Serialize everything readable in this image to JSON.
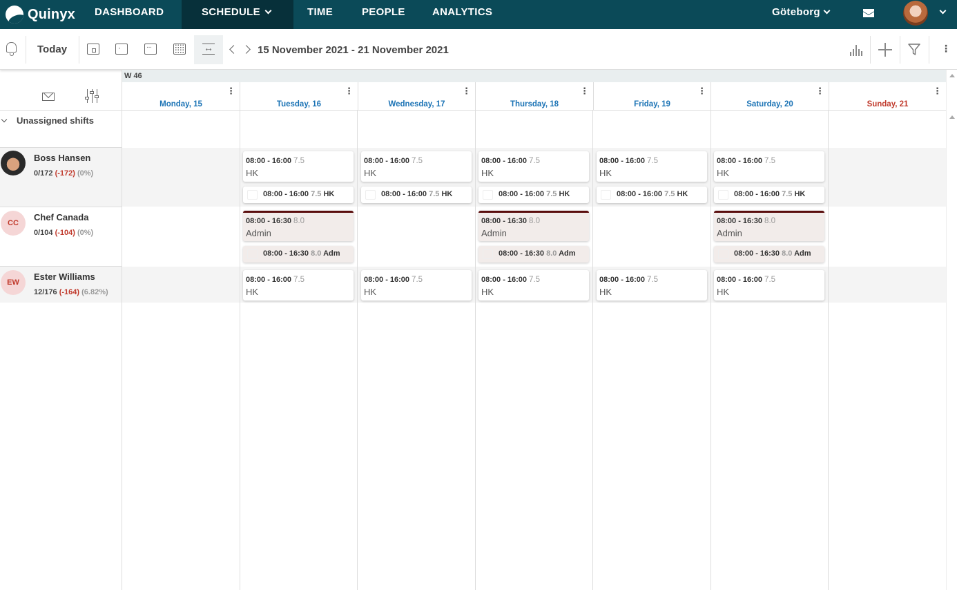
{
  "nav": {
    "logo": "Quinyx",
    "items": [
      "DASHBOARD",
      "SCHEDULE",
      "TIME",
      "PEOPLE",
      "ANALYTICS"
    ],
    "location": "Göteborg"
  },
  "toolbar": {
    "today": "Today",
    "date_range": "15 November 2021 - 21 November 2021"
  },
  "week": {
    "label": "W 46"
  },
  "days": [
    "Monday, 15",
    "Tuesday, 16",
    "Wednesday, 17",
    "Thursday, 18",
    "Friday, 19",
    "Saturday, 20",
    "Sunday, 21"
  ],
  "unassigned": {
    "label": "Unassigned shifts"
  },
  "employees": [
    {
      "name": "Boss Hansen",
      "stats1": "0/172",
      "stats2": "(-172)",
      "stats3": "(0%)",
      "initials": ""
    },
    {
      "name": "Chef Canada",
      "stats1": "0/104",
      "stats2": "(-104)",
      "stats3": "(0%)",
      "initials": "CC"
    },
    {
      "name": "Ester Williams",
      "stats1": "12/176",
      "stats2": "(-164)",
      "stats3": "(6.82%)",
      "initials": "EW"
    }
  ],
  "shifts": {
    "hk": {
      "time": "08:00 - 16:00",
      "hours": "7.5",
      "role": "HK"
    },
    "admin": {
      "time": "08:00 - 16:30",
      "hours": "8.0",
      "role": "Admin",
      "role_short": "Adm"
    }
  }
}
